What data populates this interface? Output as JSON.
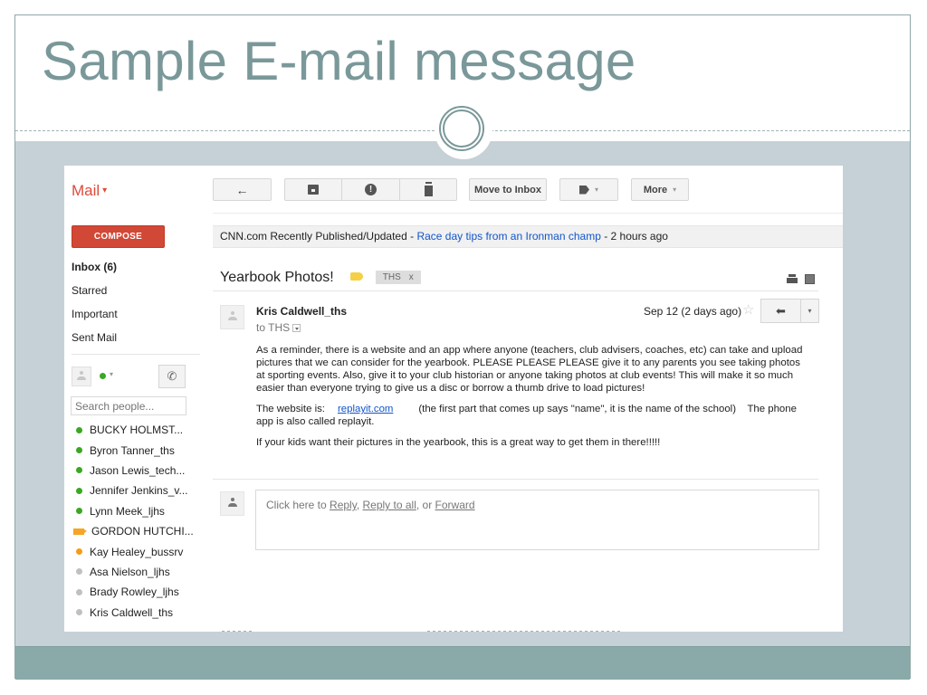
{
  "slide": {
    "title": "Sample E-mail message",
    "colors": {
      "title": "#7a9899",
      "band_gray": "#c6d1d7",
      "band_teal": "#8aaaa9"
    }
  },
  "gmail": {
    "brand": "Mail",
    "brand_caret": "▾",
    "toolbar": {
      "back_icon": "←",
      "archive_icon": "archive-icon",
      "spam_icon": "spam-icon",
      "delete_icon": "trash-icon",
      "move_to_inbox": "Move to Inbox",
      "labels_icon": "label-icon",
      "more": "More",
      "caret": "▾"
    },
    "compose": "COMPOSE",
    "nav": [
      {
        "label": "Inbox (6)",
        "bold": true
      },
      {
        "label": "Starred"
      },
      {
        "label": "Important"
      },
      {
        "label": "Sent Mail"
      }
    ],
    "chat": {
      "search_placeholder": "Search people...",
      "call_icon": "phone-icon",
      "contacts": [
        {
          "name": "BUCKY HOLMST...",
          "status": "available"
        },
        {
          "name": "Byron Tanner_ths",
          "status": "available"
        },
        {
          "name": "Jason Lewis_tech...",
          "status": "available"
        },
        {
          "name": "Jennifer Jenkins_v...",
          "status": "available"
        },
        {
          "name": "Lynn Meek_ljhs",
          "status": "available"
        },
        {
          "name": "GORDON HUTCHI...",
          "status": "video"
        },
        {
          "name": "Kay Healey_bussrv",
          "status": "idle"
        },
        {
          "name": "Asa Nielson_ljhs",
          "status": "offline"
        },
        {
          "name": "Brady Rowley_ljhs",
          "status": "offline"
        },
        {
          "name": "Kris Caldwell_ths",
          "status": "offline"
        }
      ]
    },
    "newsbar": {
      "source": "CNN.com Recently Published/Updated",
      "sep1": " - ",
      "headline": "Race day tips from an Ironman champ",
      "sep2": " - ",
      "time": "2 hours ago"
    },
    "message": {
      "subject": "Yearbook Photos!",
      "label_chip": "THS",
      "label_chip_close": "x",
      "sender": "Kris Caldwell_ths",
      "to": "to THS",
      "date": "Sep 12 (2 days ago)",
      "star": "☆",
      "reply_icon": "reply-icon",
      "more_caret": "▾",
      "paragraphs": {
        "p1": "As a reminder, there is a website and an app where anyone (teachers, club advisers, coaches, etc) can take and upload pictures that we can consider for the yearbook.  PLEASE PLEASE PLEASE give it to any parents you see taking photos at sporting events.  Also, give it to your club historian or anyone taking photos at club events!  This will make it so much easier than everyone trying to give us a disc or borrow a thumb drive to load pictures!",
        "p2_prefix": "The website is:",
        "p2_link": "replayit.com",
        "p2_suffix": "(the first part that comes up says \"name\", it is the name of the school)    The phone app is also called replayit.",
        "p3": "If your kids want their pictures in the yearbook, this is a great way to get them in there!!!!!"
      }
    },
    "reply_box": {
      "prefix": "Click here to ",
      "reply": "Reply",
      "comma": ", ",
      "reply_all": "Reply to all",
      "or": ", or ",
      "forward": "Forward"
    }
  }
}
